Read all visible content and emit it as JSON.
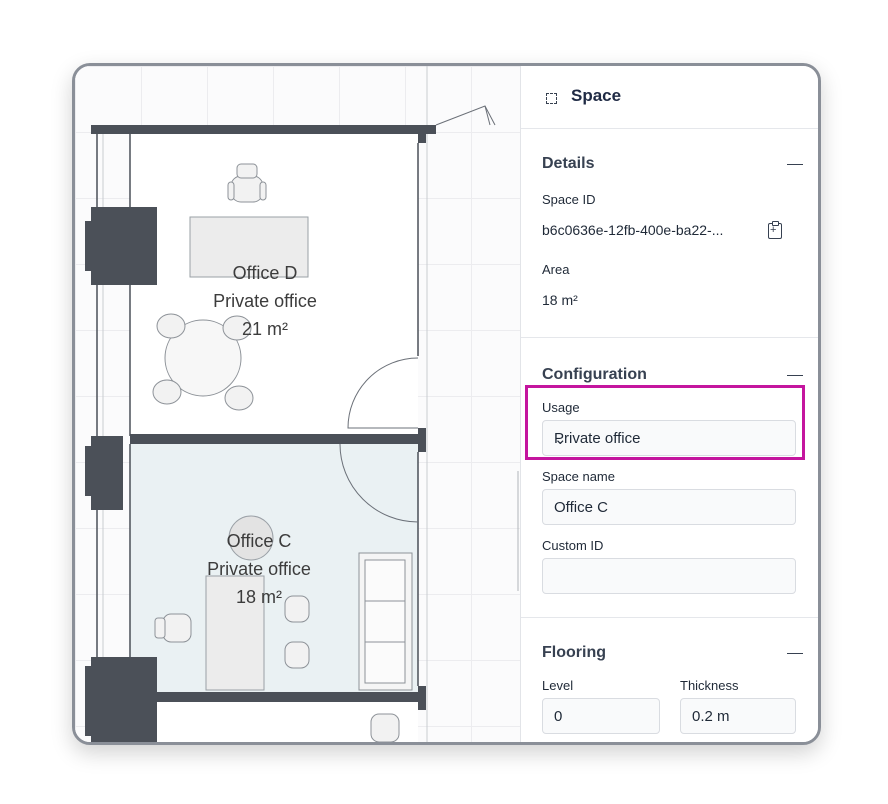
{
  "plan": {
    "rooms": [
      {
        "name": "Office D",
        "usage": "Private office",
        "area": "21 m²"
      },
      {
        "name": "Office C",
        "usage": "Private office",
        "area": "18 m²"
      }
    ]
  },
  "panel": {
    "header": {
      "icon": "dashed-square-icon",
      "title": "Space"
    },
    "details": {
      "title": "Details",
      "space_id_label": "Space ID",
      "space_id_value": "b6c0636e-12fb-400e-ba22-...",
      "copy_icon": "clipboard-icon",
      "area_label": "Area",
      "area_value": "18 m²"
    },
    "configuration": {
      "title": "Configuration",
      "usage_label": "Usage",
      "usage_value": "Private office",
      "space_name_label": "Space name",
      "space_name_value": "Office C",
      "custom_id_label": "Custom ID",
      "custom_id_value": ""
    },
    "flooring": {
      "title": "Flooring",
      "level_label": "Level",
      "level_value": "0",
      "thickness_label": "Thickness",
      "thickness_value": "0.2 m"
    }
  },
  "colors": {
    "accent_highlight": "#c4159e",
    "wall": "#4b5058",
    "selected_room": "#eaf1f3"
  }
}
